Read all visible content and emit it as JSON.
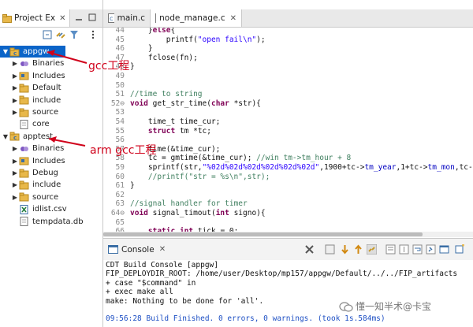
{
  "project_explorer": {
    "tab_label": "Project Ex",
    "tree": [
      {
        "label": "appgw",
        "type": "project",
        "level": 0,
        "expanded": true,
        "selected": true
      },
      {
        "label": "Binaries",
        "type": "binaries",
        "level": 1,
        "expanded": false
      },
      {
        "label": "Includes",
        "type": "includes",
        "level": 1,
        "expanded": false
      },
      {
        "label": "Default",
        "type": "folder",
        "level": 1,
        "expanded": false
      },
      {
        "label": "include",
        "type": "folder",
        "level": 1,
        "expanded": false
      },
      {
        "label": "source",
        "type": "folder",
        "level": 1,
        "expanded": false
      },
      {
        "label": "core",
        "type": "file",
        "level": 1
      },
      {
        "label": "apptest",
        "type": "project",
        "level": 0,
        "expanded": true
      },
      {
        "label": "Binaries",
        "type": "binaries",
        "level": 1,
        "expanded": false
      },
      {
        "label": "Includes",
        "type": "includes",
        "level": 1,
        "expanded": false
      },
      {
        "label": "Debug",
        "type": "folder",
        "level": 1,
        "expanded": false
      },
      {
        "label": "include",
        "type": "folder",
        "level": 1,
        "expanded": false
      },
      {
        "label": "source",
        "type": "folder",
        "level": 1,
        "expanded": false
      },
      {
        "label": "idlist.csv",
        "type": "csv",
        "level": 1
      },
      {
        "label": "tempdata.db",
        "type": "file",
        "level": 1
      }
    ]
  },
  "editor": {
    "tabs": [
      {
        "label": "main.c",
        "active": false
      },
      {
        "label": "node_manage.c",
        "active": true
      }
    ],
    "lines": [
      {
        "n": "44",
        "code": "    }else{"
      },
      {
        "n": "45",
        "code": "        printf(\"open fail\\n\");"
      },
      {
        "n": "46",
        "code": "    }"
      },
      {
        "n": "47",
        "code": "    fclose(fn);"
      },
      {
        "n": "48",
        "code": "}"
      },
      {
        "n": "49",
        "code": ""
      },
      {
        "n": "50",
        "code": ""
      },
      {
        "n": "51",
        "code": "//time to string"
      },
      {
        "n": "52⊖",
        "code": "void get_str_time(char *str){"
      },
      {
        "n": "53",
        "code": ""
      },
      {
        "n": "54",
        "code": "    time_t time_cur;"
      },
      {
        "n": "55",
        "code": "    struct tm *tc;"
      },
      {
        "n": "56",
        "code": ""
      },
      {
        "n": "57",
        "code": "    time(&time_cur);"
      },
      {
        "n": "58",
        "code": "    tc = gmtime(&time_cur); //win tm->tm_hour + 8"
      },
      {
        "n": "59",
        "code": "    sprintf(str,\"%02d%02d%02d%02d%02d%02d\",1900+tc->tm_year,1+tc->tm_mon,tc->tm_m"
      },
      {
        "n": "60",
        "code": "    //printf(\"str = %s\\n\",str);"
      },
      {
        "n": "61",
        "code": "}"
      },
      {
        "n": "62",
        "code": ""
      },
      {
        "n": "63",
        "code": "//signal handler for timer"
      },
      {
        "n": "64⊖",
        "code": "void signal_timout(int signo){"
      },
      {
        "n": "65",
        "code": ""
      },
      {
        "n": "66",
        "code": "    static int tick = 0;"
      }
    ]
  },
  "console": {
    "tab_label": "Console",
    "lines": [
      "CDT Build Console [appgw]",
      "FIP_DEPLOYDIR_ROOT: /home/user/Desktop/mp157/appgw/Default/../../FIP_artifacts",
      "+ case \"$command\" in",
      "+ exec make all",
      "make: Nothing to be done for 'all'.",
      "",
      "09:56:28 Build Finished. 0 errors, 0 warnings. (took 1s.584ms)"
    ]
  },
  "annotations": {
    "gcc": "gcc工程",
    "arm_gcc": "arm gcc工程"
  },
  "watermark": "懂一知半术@卡宝",
  "colors": {
    "selection": "#0a64c8",
    "annotation": "#d0021b",
    "keyword": "#7f0055",
    "comment": "#3f7f5f",
    "string": "#2a00ff"
  }
}
